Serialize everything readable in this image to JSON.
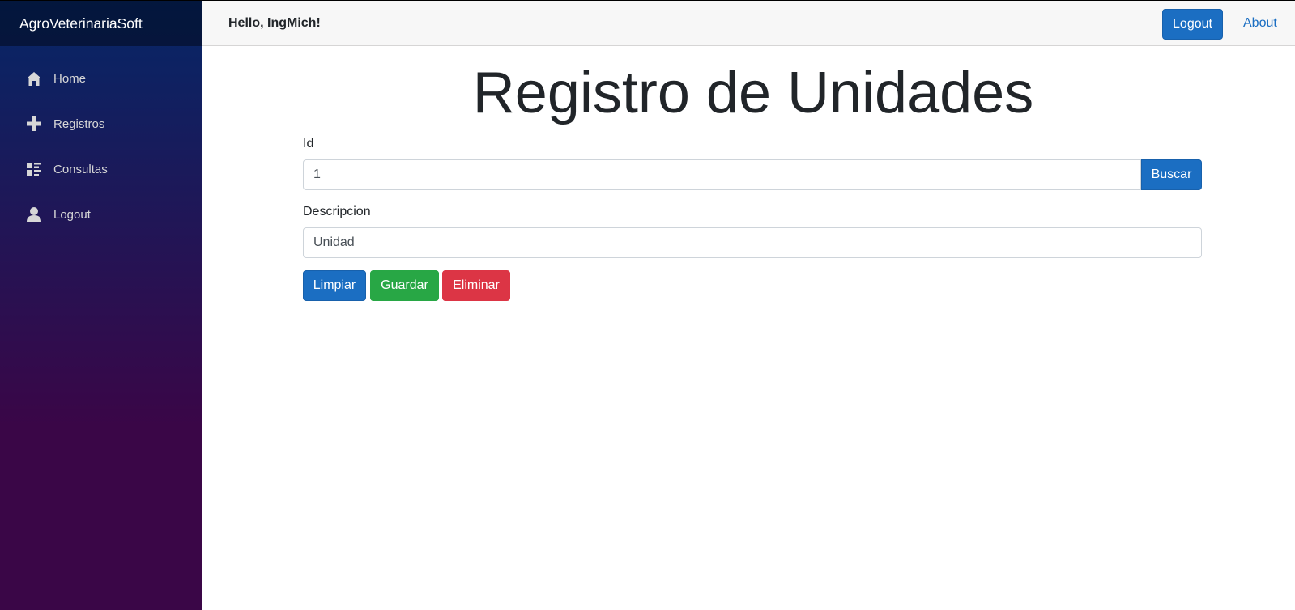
{
  "app": {
    "brand": "AgroVeterinariaSoft"
  },
  "sidebar": {
    "items": [
      {
        "label": "Home",
        "icon": "home-icon"
      },
      {
        "label": "Registros",
        "icon": "plus-icon"
      },
      {
        "label": "Consultas",
        "icon": "list-icon"
      },
      {
        "label": "Logout",
        "icon": "person-icon"
      }
    ]
  },
  "topbar": {
    "greeting": "Hello, IngMich!",
    "logout_label": "Logout",
    "about_label": "About"
  },
  "form": {
    "title": "Registro de Unidades",
    "id_label": "Id",
    "id_value": "1",
    "search_label": "Buscar",
    "description_label": "Descripcion",
    "description_value": "Unidad",
    "clear_label": "Limpiar",
    "save_label": "Guardar",
    "delete_label": "Eliminar"
  },
  "colors": {
    "primary": "#1b6ec2",
    "success": "#28a745",
    "danger": "#dc3545",
    "sidebar_top": "#052767",
    "sidebar_bottom": "#3a0647"
  }
}
